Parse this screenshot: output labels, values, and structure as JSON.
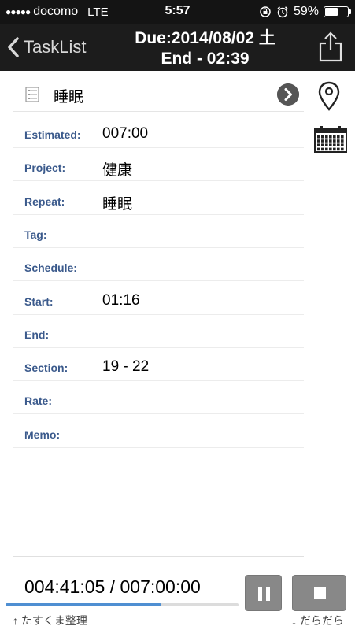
{
  "status_bar": {
    "signal": "●●●●●",
    "carrier": "docomo",
    "network": "LTE",
    "time": "5:57",
    "battery_text": "59%",
    "battery_level": 0.59,
    "icons": [
      "orientation-lock-icon",
      "alarm-icon",
      "battery-icon"
    ]
  },
  "nav": {
    "back_label": "TaskList",
    "title_line1": "Due:2014/08/02 土",
    "title_line2": "End - 02:39",
    "share_icon": "share-icon"
  },
  "task": {
    "name": "睡眠",
    "icons": [
      "list-icon",
      "chevron-right-icon"
    ]
  },
  "fields": [
    {
      "label": "Estimated:",
      "value": "007:00"
    },
    {
      "label": "Project:",
      "value": "健康"
    },
    {
      "label": "Repeat:",
      "value": "睡眠"
    },
    {
      "label": "Tag:",
      "value": ""
    },
    {
      "label": "Schedule:",
      "value": ""
    },
    {
      "label": "Start:",
      "value": "01:16"
    },
    {
      "label": "End:",
      "value": ""
    },
    {
      "label": "Section:",
      "value": "19 - 22"
    },
    {
      "label": "Rate:",
      "value": ""
    },
    {
      "label": "Memo:",
      "value": ""
    }
  ],
  "side_icons": [
    "map-pin-icon",
    "calendar-icon"
  ],
  "footer": {
    "timer": "004:41:05 / 007:00:00",
    "progress": 0.67,
    "hint_left": "↑ たすくま整理",
    "hint_right": "↓ だらだら",
    "buttons": [
      "pause-icon",
      "stop-icon"
    ]
  },
  "colors": {
    "label": "#3b5a8c",
    "nav_bg": "#1c1c1c",
    "progress_fill": "#4f8fd2",
    "button_bg": "#888888"
  }
}
